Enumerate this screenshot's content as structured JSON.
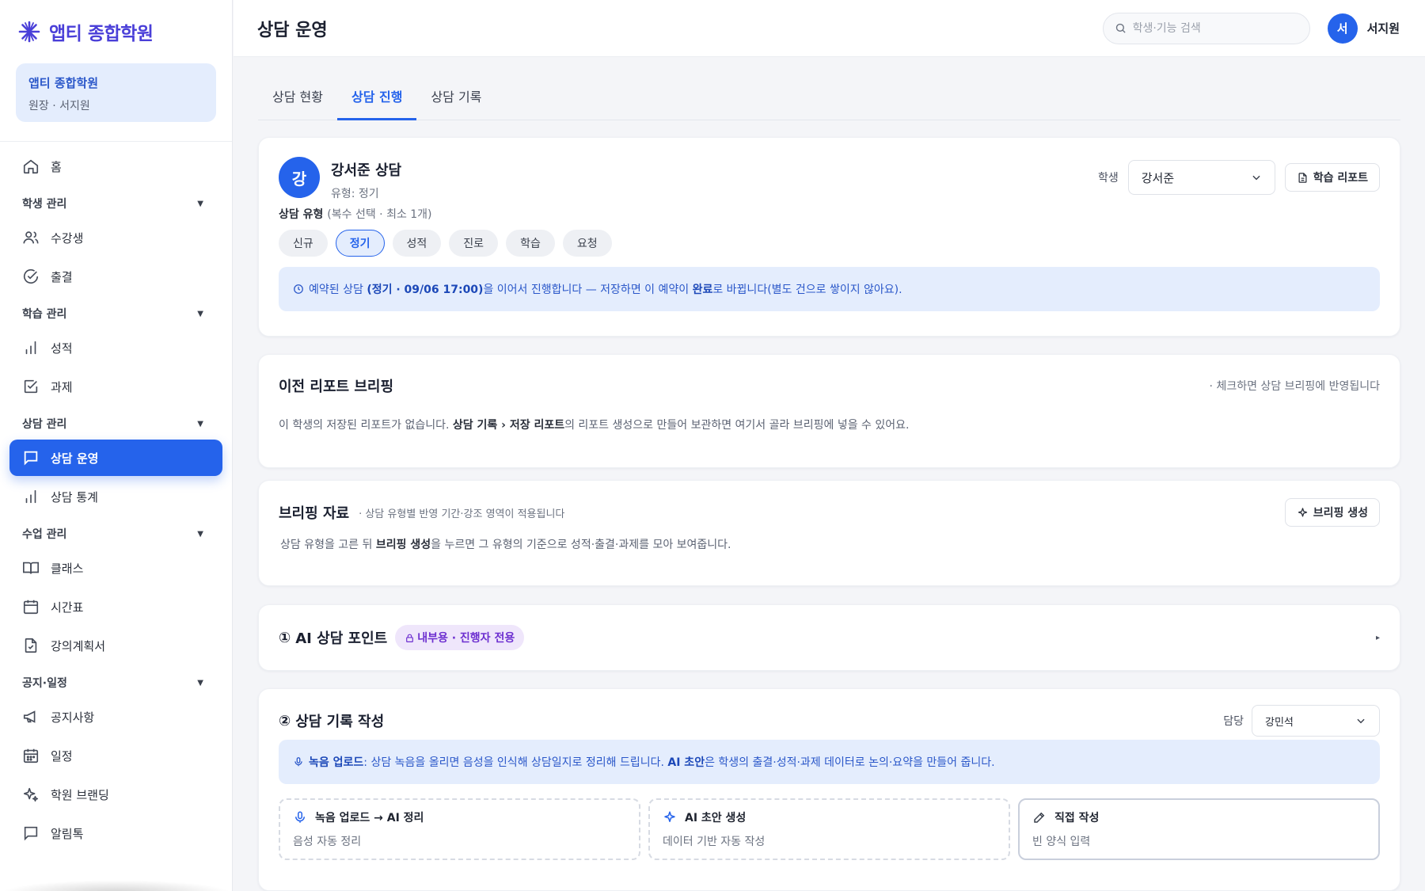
{
  "brand": {
    "name": "앱티 종합학원"
  },
  "org": {
    "name": "앱티 종합학원",
    "role": "원장 · 서지원"
  },
  "header": {
    "title": "상담 운영",
    "search_placeholder": "학생·기능 검색",
    "user_initial": "서",
    "user_name": "서지원"
  },
  "sidebar": {
    "home": "홈",
    "sections": [
      {
        "label": "학생 관리",
        "items": [
          "수강생",
          "출결"
        ]
      },
      {
        "label": "학습 관리",
        "items": [
          "성적",
          "과제"
        ]
      },
      {
        "label": "상담 관리",
        "items": [
          "상담 운영",
          "상담 통계"
        ]
      },
      {
        "label": "수업 관리",
        "items": [
          "클래스",
          "시간표",
          "강의계획서"
        ]
      },
      {
        "label": "공지·일정",
        "items": [
          "공지사항",
          "일정",
          "학원 브랜딩",
          "알림톡"
        ]
      }
    ],
    "active": "상담 운영"
  },
  "tabs": [
    {
      "label": "상담 현황"
    },
    {
      "label": "상담 진행"
    },
    {
      "label": "상담 기록"
    }
  ],
  "session": {
    "avatar": "강",
    "title": "강서준 상담",
    "subtitle": "유형: 정기",
    "student_label": "학생",
    "student_value": "강서준",
    "report_button": "학습 리포트",
    "type_label": "상담 유형",
    "type_hint": "(복수 선택 · 최소 1개)",
    "types": [
      "신규",
      "정기",
      "성적",
      "진로",
      "학습",
      "요청"
    ],
    "selected_type": "정기",
    "notice_pre": "예약된 상담 ",
    "notice_bold1": "(정기 · 09/06 17:00)",
    "notice_mid": "을 이어서 진행합니다 — 저장하면 이 예약이 ",
    "notice_bold2": "완료",
    "notice_post": "로 바뀝니다(별도 건으로 쌓이지 않아요)."
  },
  "prev_report": {
    "title": "이전 리포트 브리핑",
    "right_note": "· 체크하면 상담 브리핑에 반영됩니다",
    "body_pre": "이 학생의 저장된 리포트가 없습니다. ",
    "body_bold": "상담 기록 › 저장 리포트",
    "body_post": "의 리포트 생성으로 만들어 보관하면 여기서 골라 브리핑에 넣을 수 있어요."
  },
  "briefing": {
    "title": "브리핑 자료",
    "subtitle": "· 상담 유형별 반영 기간·강조 영역이 적용됩니다",
    "button": "브리핑 생성",
    "body_pre": "상담 유형을 고른 뒤 ",
    "body_bold": "브리핑 생성",
    "body_post": "을 누르면 그 유형의 기준으로 성적·출결·과제를 모아 보여줍니다."
  },
  "ai_points": {
    "number": "①",
    "title": "AI 상담 포인트",
    "badge": "내부용 · 진행자 전용"
  },
  "record": {
    "number": "②",
    "title": "상담 기록 작성",
    "owner_label": "담당",
    "owner_value": "강민석",
    "notice_bold1": "녹음 업로드",
    "notice_mid": ": 상담 녹음을 올리면 음성을 인식해 상담일지로 정리해 드립니다. ",
    "notice_bold2": "AI 초안",
    "notice_post": "은 학생의 출결·성적·과제 데이터로 논의·요약을 만들어 줍니다.",
    "options": [
      {
        "title": "녹음 업로드 → AI 정리",
        "subtitle": "음성 자동 정리",
        "icon": "mic-icon"
      },
      {
        "title": "AI 초안 생성",
        "subtitle": "데이터 기반 자동 작성",
        "icon": "sparkle-icon"
      },
      {
        "title": "직접 작성",
        "subtitle": "빈 양식 입력",
        "icon": "pencil-icon"
      }
    ]
  },
  "colors": {
    "primary": "#2563eb",
    "brand": "#4a3fd8",
    "info_bg": "#e4edfd",
    "badge_bg": "#efe6fb",
    "badge_text": "#6d2fd0"
  }
}
